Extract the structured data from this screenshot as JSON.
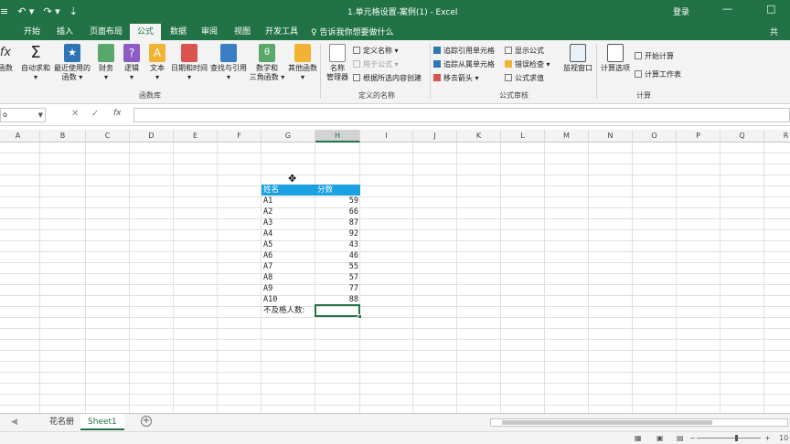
{
  "titlebar": {
    "qat": [
      "≡",
      "↶ ▾",
      "↷ ▾",
      "⇣"
    ],
    "title": "1.单元格设置-案例(1)  -  Excel",
    "login": "登录",
    "minimize": "—",
    "maximize": "□"
  },
  "tabs": {
    "items": [
      "开始",
      "插入",
      "页面布局",
      "公式",
      "数据",
      "审阅",
      "视图",
      "开发工具"
    ],
    "active": "公式",
    "tellme": "告诉我你想要做什么",
    "share": "共"
  },
  "ribbon": {
    "library": {
      "buttons": [
        {
          "label": "函数",
          "sub": ""
        },
        {
          "label": "自动求和",
          "sub": "▾"
        },
        {
          "label": "最近使用的",
          "sub": "函数 ▾"
        },
        {
          "label": "财务",
          "sub": "▾"
        },
        {
          "label": "逻辑",
          "sub": "▾"
        },
        {
          "label": "文本",
          "sub": "▾"
        },
        {
          "label": "日期和时间",
          "sub": "▾"
        },
        {
          "label": "查找与引用",
          "sub": "▾"
        },
        {
          "label": "数学和",
          "sub": "三角函数 ▾"
        },
        {
          "label": "其他函数",
          "sub": "▾"
        }
      ],
      "group": "函数库"
    },
    "names": {
      "manager": "名称",
      "manager2": "管理器",
      "define": "定义名称 ▾",
      "use_in_formula": "用于公式 ▾",
      "create_from_selection": "根据所选内容创建",
      "group": "定义的名称"
    },
    "audit": {
      "trace_precedents": "追踪引用单元格",
      "trace_dependents": "追踪从属单元格",
      "remove_arrows": "移去箭头 ▾",
      "show_formulas": "显示公式",
      "error_checking": "错误检查 ▾",
      "evaluate": "公式求值",
      "watch": "监视窗口",
      "group": "公式审核"
    },
    "calc": {
      "options": "计算选项",
      "calc_now": "开始计算",
      "calc_sheet": "计算工作表",
      "group": "计算"
    }
  },
  "formula_bar": {
    "name_box": "o",
    "cancel": "✕",
    "enter": "✓",
    "fx": "fx",
    "value": ""
  },
  "columns": [
    "A",
    "B",
    "C",
    "D",
    "E",
    "F",
    "G",
    "H",
    "I",
    "J",
    "K",
    "L",
    "M",
    "N",
    "O",
    "P",
    "Q",
    "R"
  ],
  "selected_column": "H",
  "table": {
    "headers": [
      "姓名",
      "分数"
    ],
    "rows": [
      [
        "A1",
        "59"
      ],
      [
        "A2",
        "66"
      ],
      [
        "A3",
        "87"
      ],
      [
        "A4",
        "92"
      ],
      [
        "A5",
        "43"
      ],
      [
        "A6",
        "46"
      ],
      [
        "A7",
        "55"
      ],
      [
        "A8",
        "57"
      ],
      [
        "A9",
        "77"
      ],
      [
        "A10",
        "88"
      ]
    ],
    "footer_label": "不及格人数:"
  },
  "sheets": {
    "items": [
      "花名册",
      "Sheet1"
    ],
    "active": "Sheet1",
    "add": "+"
  },
  "statusbar": {
    "zoom_text": "10"
  },
  "colors": {
    "excel_green": "#217346",
    "header_blue": "#1ba1e2"
  }
}
